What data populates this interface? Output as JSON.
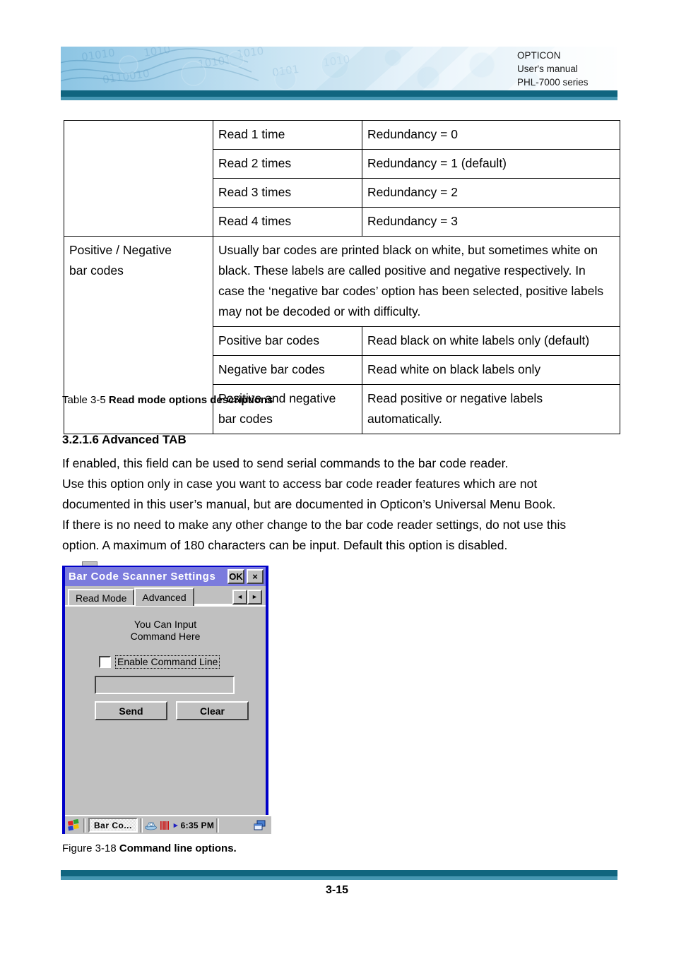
{
  "header": {
    "brand": "OPTICON",
    "doc_type": "User's manual",
    "product": "PHL-7000 series",
    "banner_art_name": "abstract-blue-technology-banner",
    "rule_dark_color": "#10657f",
    "rule_light_color": "#4596b2"
  },
  "table": {
    "caption_prefix": "Table 3-5 ",
    "caption_bold": "Read mode options descriptions",
    "rows": [
      {
        "label": "",
        "option": "Read 1 time",
        "description": "Redundancy = 0"
      },
      {
        "label": "",
        "option": "Read 2 times",
        "description": "Redundancy = 1 (default)"
      },
      {
        "label": "",
        "option": "Read 3 times",
        "description": "Redundancy = 2"
      },
      {
        "label": "",
        "option": "Read 4 times",
        "description": "Redundancy = 3"
      }
    ],
    "positive_negative": {
      "label_line1": "Positive / Negative",
      "label_line2": "bar codes",
      "description": "Usually bar codes are printed black on white, but sometimes white on black. These labels are called positive and negative respectively. In case the ‘negative bar codes’ option has been selected, positive labels may not be decoded or with difficulty."
    },
    "sub_rows": [
      {
        "option": "Positive bar codes",
        "description": "Read black on white labels only (default)"
      },
      {
        "option": "Negative bar codes",
        "description": "Read white on black labels only"
      },
      {
        "option": "Positive and negative bar codes",
        "description": "Read positive or negative labels automatically."
      }
    ]
  },
  "section": {
    "heading": "3.2.1.6 Advanced TAB",
    "lines": [
      "If enabled, this field can be used to send serial commands to the bar code reader.",
      "Use this option only in case you want to access bar code reader features which are not",
      "documented in this user’s manual, but are documented in Opticon’s Universal Menu Book.",
      "If there is no need to make any other change to the bar code reader settings, do not use this",
      "option. A maximum of 180 characters can be input. Default this option is disabled."
    ]
  },
  "device": {
    "title": "Bar Code Scanner Settings",
    "titlebar_color": "#7b7bdd",
    "frame_color": "#0000c8",
    "body_color": "#c0c0c0",
    "ok_button": "OK",
    "close_button": "×",
    "tabs": [
      {
        "label": "Read Mode",
        "active": false
      },
      {
        "label": "Advanced",
        "active": true
      }
    ],
    "scroll_left": "◄",
    "scroll_right": "►",
    "prompt_line1": "You Can Input",
    "prompt_line2": "Command Here",
    "checkbox_label": "Enable Command Line",
    "checkbox_checked": false,
    "command_input_value": "",
    "command_input_placeholder": "",
    "send_button": "Send",
    "clear_button": "Clear",
    "taskbar": {
      "start_icon": "windows-start-icon",
      "task_button": "Bar Co...",
      "scanner_icon": "scanner-icon",
      "barcode_icon": "barcode-icon",
      "play_icon": "▸",
      "clock": "6:35 PM",
      "desktop_icon": "show-desktop-icon"
    }
  },
  "figure": {
    "caption_prefix": "Figure 3-18 ",
    "caption_bold": "Command line options."
  },
  "footer": {
    "page_number": "3-15",
    "rule_dark_color": "#10657f",
    "rule_light_color": "#4596b2"
  }
}
